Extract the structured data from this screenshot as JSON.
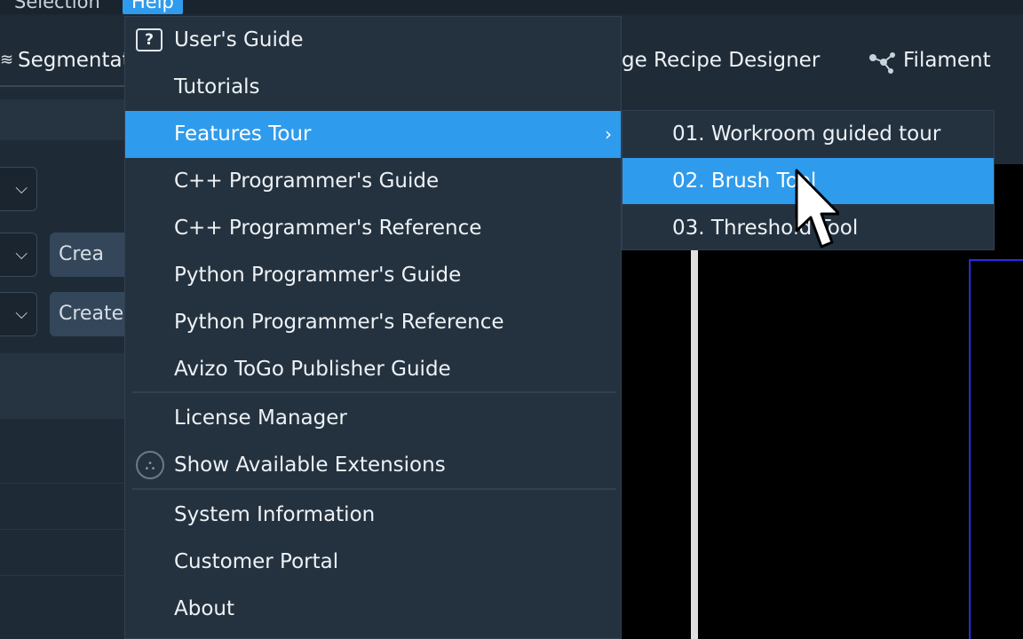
{
  "menubar": {
    "items": [
      "Selection",
      "Help"
    ]
  },
  "toolbar": {
    "segmentation_tab": "Segmentat",
    "segmentation_icon": "layers-icon",
    "recipe_tab": "ge Recipe Designer",
    "filament_tab": "Filament",
    "filament_icon": "filament-network-icon"
  },
  "left_panel": {
    "create_buttons": [
      "Crea",
      "Create"
    ],
    "dropdown_chevron": "⌵"
  },
  "help_menu": {
    "items": [
      {
        "label": "User's Guide",
        "icon": "help-icon",
        "glyph": "?"
      },
      {
        "label": "Tutorials"
      },
      {
        "label": "Features Tour",
        "highlighted": true,
        "submenu_arrow": "›"
      },
      {
        "label": "C++ Programmer's Guide"
      },
      {
        "label": "C++ Programmer's Reference"
      },
      {
        "label": "Python Programmer's Guide"
      },
      {
        "label": "Python Programmer's Reference"
      },
      {
        "label": "Avizo ToGo Publisher Guide"
      },
      {
        "label": "License Manager"
      },
      {
        "label": "Show Available Extensions",
        "icon": "extensions-icon",
        "glyph": "⛬"
      },
      {
        "label": "System Information"
      },
      {
        "label": "Customer Portal"
      },
      {
        "label": "About"
      }
    ]
  },
  "features_tour_submenu": {
    "items": [
      {
        "label": "01. Workroom guided tour"
      },
      {
        "label": "02. Brush Tool",
        "highlighted": true
      },
      {
        "label": "03. Threshold Tool"
      }
    ]
  },
  "colors": {
    "highlight": "#2f9bec",
    "menu_bg": "#243240",
    "app_bg": "#1d2935"
  }
}
